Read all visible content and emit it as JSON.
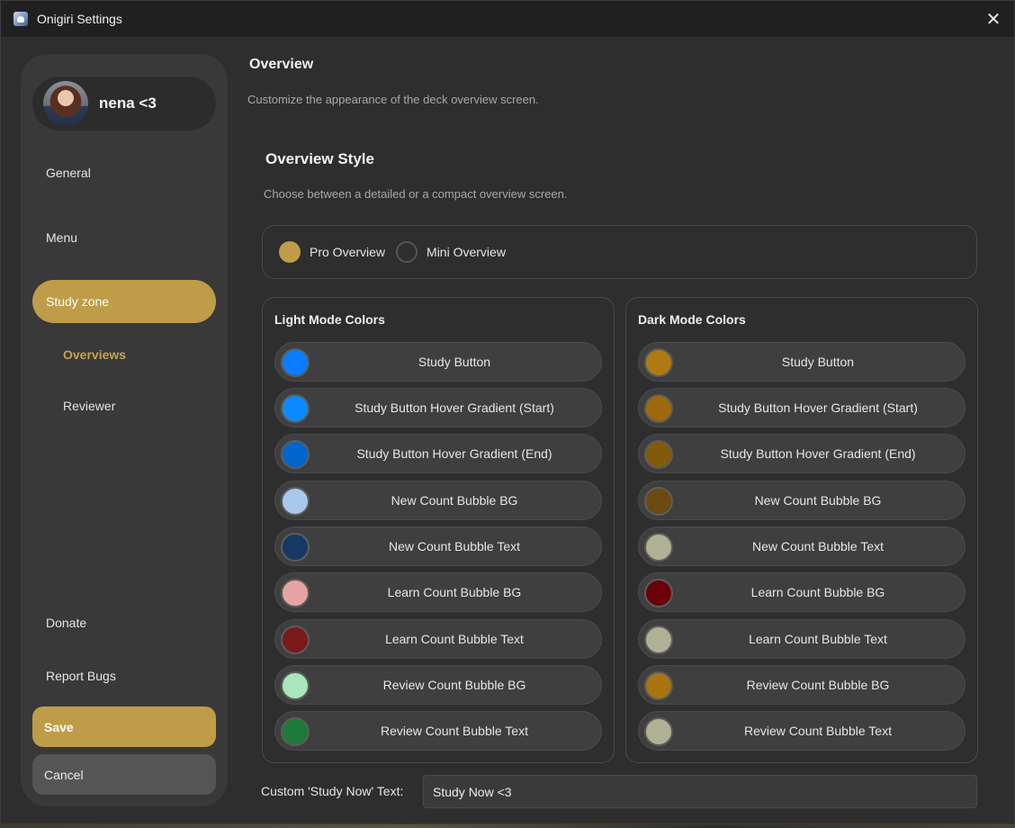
{
  "window": {
    "title": "Onigiri Settings",
    "close_icon": "close-icon"
  },
  "sidebar": {
    "profile_name": "nena <3",
    "nav": [
      {
        "label": "General",
        "active": false
      },
      {
        "label": "Menu",
        "active": false
      },
      {
        "label": "Study zone",
        "active": true
      }
    ],
    "sub": [
      {
        "label": "Overviews",
        "active": true
      },
      {
        "label": "Reviewer",
        "active": false
      }
    ],
    "bottom": [
      {
        "label": "Donate"
      },
      {
        "label": "Report Bugs"
      }
    ],
    "save_label": "Save",
    "cancel_label": "Cancel"
  },
  "main": {
    "title": "Overview",
    "description": "Customize the appearance of the deck overview screen.",
    "style_section": {
      "title": "Overview Style",
      "description": "Choose between a detailed or a compact overview screen.",
      "options": [
        {
          "label": "Pro Overview",
          "checked": true
        },
        {
          "label": "Mini Overview",
          "checked": false
        }
      ]
    },
    "light_colors": {
      "title": "Light Mode Colors",
      "rows": [
        {
          "label": "Study Button",
          "color": "#0a7cff"
        },
        {
          "label": "Study Button Hover Gradient (Start)",
          "color": "#0a8bff"
        },
        {
          "label": "Study Button Hover Gradient (End)",
          "color": "#0065cc"
        },
        {
          "label": "New Count Bubble BG",
          "color": "#a8c8ec"
        },
        {
          "label": "New Count Bubble Text",
          "color": "#173863"
        },
        {
          "label": "Learn Count Bubble BG",
          "color": "#e8a4a4"
        },
        {
          "label": "Learn Count Bubble Text",
          "color": "#7a1a1a"
        },
        {
          "label": "Review Count Bubble BG",
          "color": "#a8e6bc"
        },
        {
          "label": "Review Count Bubble Text",
          "color": "#1e7a3a"
        }
      ]
    },
    "dark_colors": {
      "title": "Dark Mode Colors",
      "rows": [
        {
          "label": "Study Button",
          "color": "#b07a12"
        },
        {
          "label": "Study Button Hover Gradient (Start)",
          "color": "#9c6a0c"
        },
        {
          "label": "Study Button Hover Gradient (End)",
          "color": "#825a0a"
        },
        {
          "label": "New Count Bubble BG",
          "color": "#6a4a10"
        },
        {
          "label": "New Count Bubble Text",
          "color": "#b0b094"
        },
        {
          "label": "Learn Count Bubble BG",
          "color": "#6a0008"
        },
        {
          "label": "Learn Count Bubble Text",
          "color": "#b0b094"
        },
        {
          "label": "Review Count Bubble BG",
          "color": "#a87410"
        },
        {
          "label": "Review Count Bubble Text",
          "color": "#b0b094"
        }
      ]
    },
    "custom_text": {
      "label": "Custom 'Study Now' Text:",
      "value": "Study Now <3"
    }
  },
  "colors": {
    "accent": "#bf9c47",
    "panel_bg": "#393939",
    "window_bg": "#2e2e2e"
  }
}
